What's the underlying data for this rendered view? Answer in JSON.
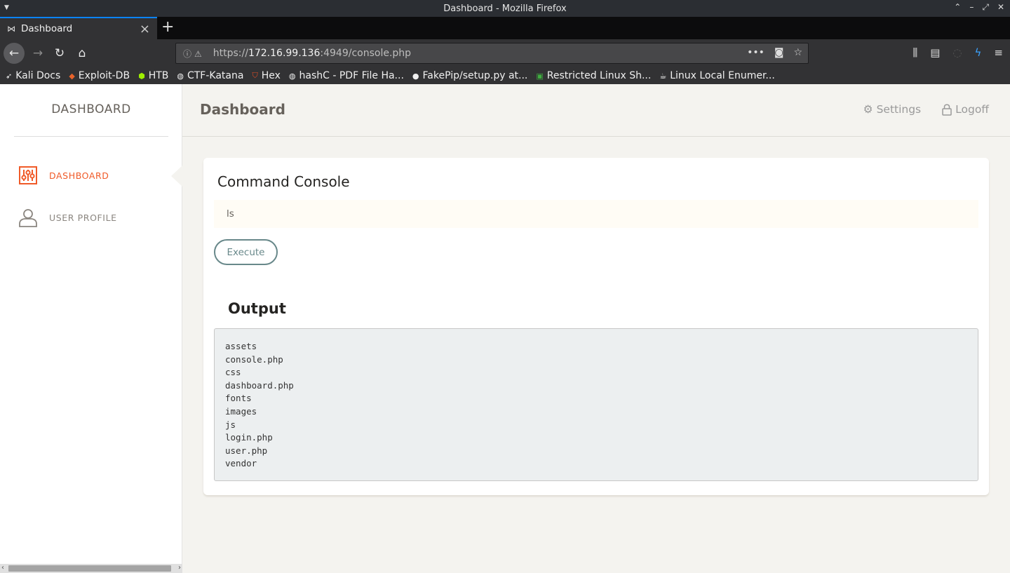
{
  "window": {
    "title": "Dashboard - Mozilla Firefox"
  },
  "tab": {
    "label": "Dashboard"
  },
  "urlbar": {
    "scheme": "https://",
    "host": "172.16.99.136",
    "rest": ":4949/console.php"
  },
  "bookmarks": [
    {
      "label": "Kali Docs",
      "icon": "kali-icon"
    },
    {
      "label": "Exploit-DB",
      "icon": "exploitdb-icon"
    },
    {
      "label": "HTB",
      "icon": "htb-icon"
    },
    {
      "label": "CTF-Katana",
      "icon": "globe-icon"
    },
    {
      "label": "Hex",
      "icon": "html5-icon"
    },
    {
      "label": "hashC - PDF File Ha...",
      "icon": "globe-icon"
    },
    {
      "label": "FakePip/setup.py at...",
      "icon": "github-icon"
    },
    {
      "label": "Restricted Linux Sh...",
      "icon": "terminal-icon"
    },
    {
      "label": "Linux Local Enumer...",
      "icon": "coffee-icon"
    }
  ],
  "sidebar": {
    "logo": "DASHBOARD",
    "items": [
      {
        "label": "DASHBOARD",
        "active": true,
        "icon": "sliders-icon"
      },
      {
        "label": "USER PROFILE",
        "active": false,
        "icon": "user-icon"
      }
    ]
  },
  "header": {
    "title": "Dashboard",
    "settings_label": "Settings",
    "logoff_label": "Logoff"
  },
  "console": {
    "title": "Command Console",
    "input_value": "ls",
    "execute_label": "Execute",
    "output_title": "Output",
    "output_lines": [
      "assets",
      "console.php",
      "css",
      "dashboard.php",
      "fonts",
      "images",
      "js",
      "login.php",
      "user.php",
      "vendor"
    ]
  },
  "colors": {
    "accent": "#f05a28",
    "button": "#68888a",
    "page_bg": "#f4f3ef",
    "input_bg": "#fffcf5",
    "output_bg": "#eceff0"
  }
}
